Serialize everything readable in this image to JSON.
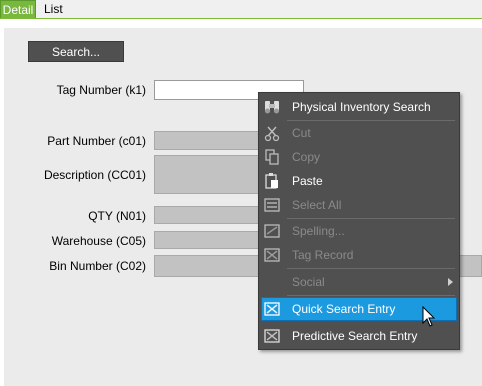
{
  "tabs": [
    "Detail",
    "List"
  ],
  "search_button": "Search...",
  "fields": {
    "tag_number": {
      "label": "Tag Number (k1)",
      "value": ""
    },
    "part_number": {
      "label": "Part Number (c01)",
      "value": ""
    },
    "description": {
      "label": "Description (CC01)",
      "value": ""
    },
    "qty": {
      "label": "QTY (N01)",
      "value": ""
    },
    "warehouse": {
      "label": "Warehouse (C05)",
      "value": ""
    },
    "bin_number": {
      "label": "Bin Number (C02)",
      "value": ""
    }
  },
  "context_menu": {
    "items": [
      {
        "label": "Physical Inventory Search",
        "icon": "binoculars-icon",
        "enabled": true
      },
      {
        "label": "Cut",
        "icon": "scissors-icon",
        "enabled": false
      },
      {
        "label": "Copy",
        "icon": "copy-icon",
        "enabled": false
      },
      {
        "label": "Paste",
        "icon": "paste-icon",
        "enabled": true
      },
      {
        "label": "Select All",
        "icon": "select-all-icon",
        "enabled": false
      },
      {
        "label": "Spelling...",
        "icon": "spelling-icon",
        "enabled": false
      },
      {
        "label": "Tag Record",
        "icon": "tag-record-icon",
        "enabled": false
      },
      {
        "label": "Social",
        "icon": "",
        "enabled": false,
        "submenu": true
      },
      {
        "label": "Quick Search Entry",
        "icon": "quick-search-icon",
        "enabled": true,
        "highlighted": true
      },
      {
        "label": "Predictive Search Entry",
        "icon": "predictive-search-icon",
        "enabled": true
      }
    ]
  },
  "colors": {
    "active_tab": "#79b73f",
    "menu_background": "#505050",
    "menu_highlight": "#1c9ae0",
    "field_background": "#c2c2c2"
  }
}
